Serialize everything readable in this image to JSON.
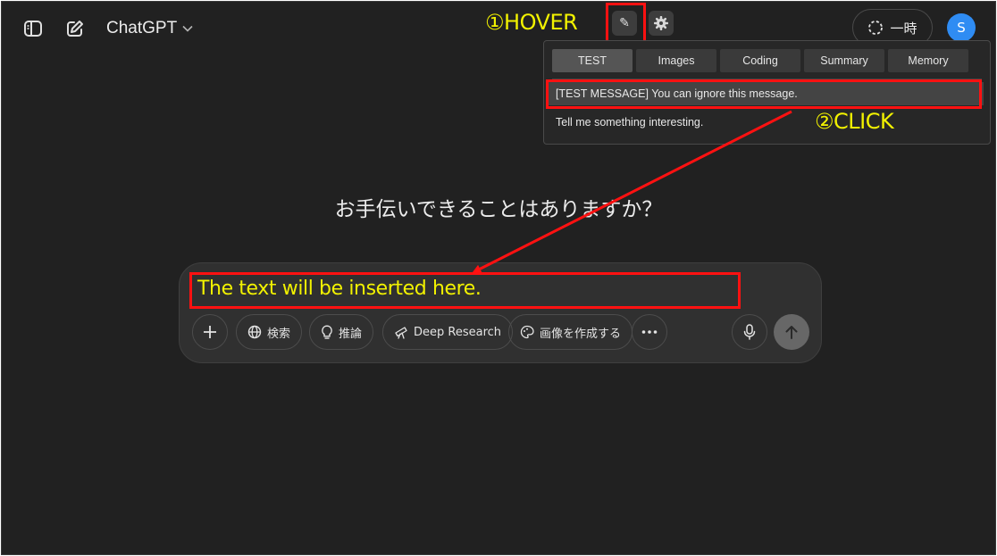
{
  "header": {
    "model_name": "ChatGPT",
    "temporary_chat_label": "一時",
    "avatar_initial": "S"
  },
  "annotations": {
    "step1": "①HOVER",
    "step2": "②CLICK"
  },
  "extension": {
    "button_icon": "pencil-icon",
    "settings_icon": "gear-icon",
    "tabs": [
      {
        "label": "TEST",
        "active": true
      },
      {
        "label": "Images",
        "active": false
      },
      {
        "label": "Coding",
        "active": false
      },
      {
        "label": "Summary",
        "active": false
      },
      {
        "label": "Memory",
        "active": false
      }
    ],
    "items": [
      {
        "text": "[TEST MESSAGE] You can ignore this message.",
        "highlighted": true
      },
      {
        "text": "Tell me something interesting.",
        "highlighted": false
      }
    ]
  },
  "main": {
    "greeting": "お手伝いできることはありますか？"
  },
  "composer": {
    "inserted_text": "The text will be inserted here.",
    "tools": {
      "search": "検索",
      "reason": "推論",
      "deep_research": "Deep Research",
      "create_image": "画像を作成する"
    }
  },
  "colors": {
    "background": "#212121",
    "annotation_red": "#ff1111",
    "annotation_yellow": "#f2f200",
    "avatar": "#2f8cf3"
  }
}
